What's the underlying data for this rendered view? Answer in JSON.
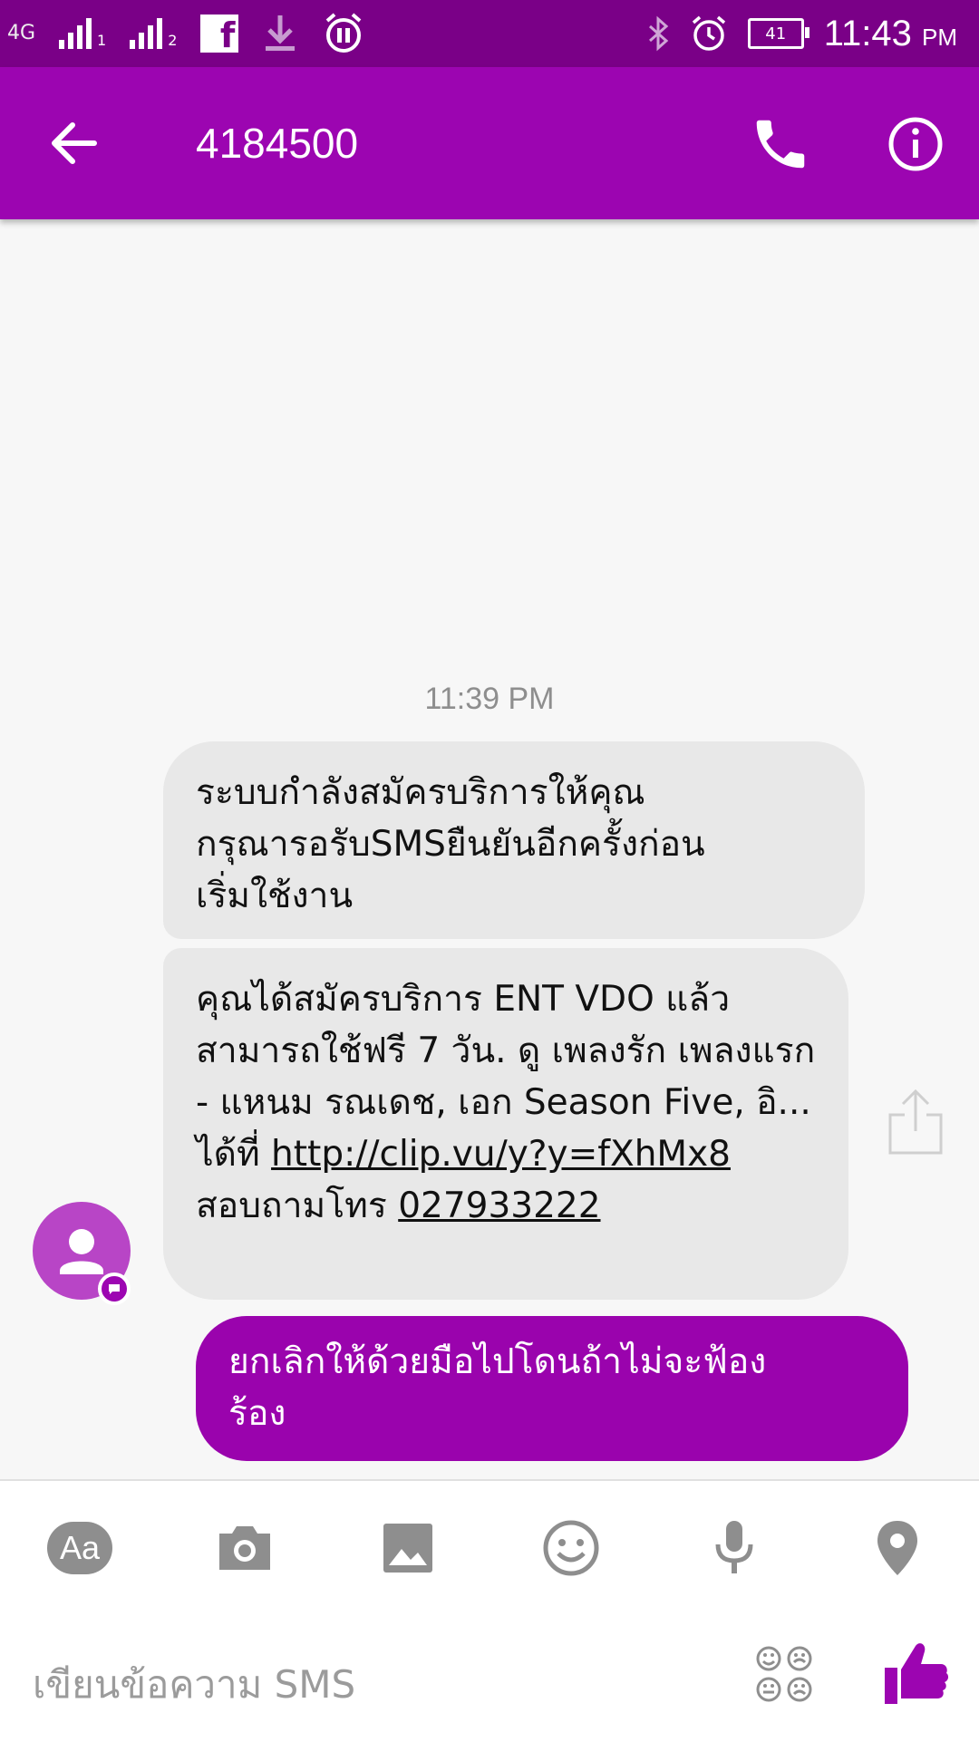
{
  "status_bar": {
    "network": "4G",
    "sim1": "1",
    "sim2": "2",
    "facebook": "f",
    "battery": "41",
    "time": "11:43",
    "ampm": "PM"
  },
  "header": {
    "contact": "4184500"
  },
  "conversation": {
    "timestamp": "11:39 PM",
    "msg1": "ระบบกำลังสมัครบริการให้คุณ\nกรุณารอรับSMSยืนยันอีกครั้งก่อน\nเริ่มใช้งาน",
    "msg2_text": "คุณได้สมัครบริการ ENT VDO แล้ว สามารถใช้ฟรี 7 วัน. ดู เพลงรัก เพลงแรก - แหนม รณเดช, เอก Season Five, อิ... ได้ที่ ",
    "msg2_link": "http://clip.vu/y?y=fXhMx8",
    "msg2_mid": " สอบถามโทร ",
    "msg2_phone": "027933222",
    "msg3": "ยกเลิกให้ด้วยมือไปโดนถ้าไม่จะฟ้อง\nร้อง"
  },
  "composer": {
    "aa_label": "Aa",
    "placeholder": "เขียนข้อความ SMS"
  },
  "colors": {
    "status_bar": "#7a0087",
    "app_bar": "#9c05b1",
    "outgoing_bubble": "#9a03ad",
    "incoming_bubble": "#e8e8e8"
  },
  "icons": [
    "back-arrow-icon",
    "phone-icon",
    "info-icon",
    "share-icon",
    "camera-icon",
    "image-icon",
    "emoji-icon",
    "mic-icon",
    "location-icon",
    "sticker-grid-icon",
    "thumbs-up-icon",
    "person-icon"
  ]
}
